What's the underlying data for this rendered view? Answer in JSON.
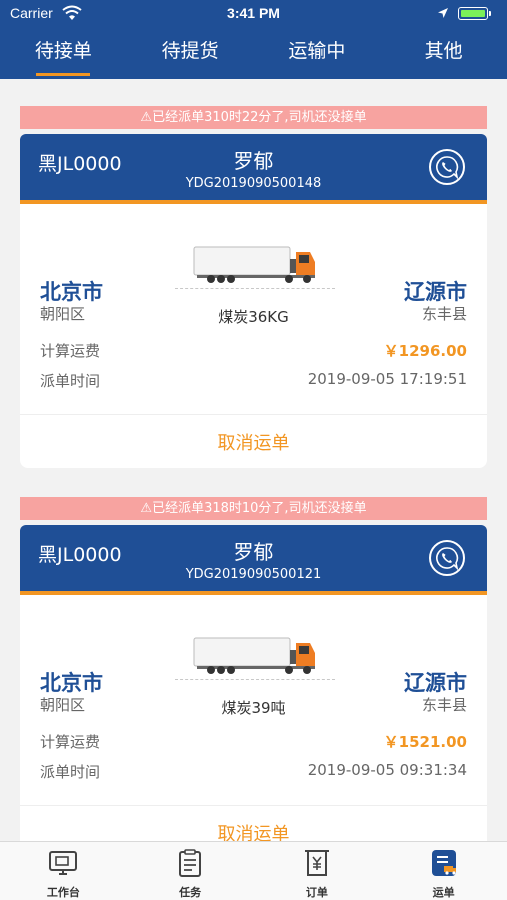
{
  "status_bar": {
    "carrier": "Carrier",
    "time": "3:41 PM"
  },
  "tabs": [
    {
      "label": "待接单",
      "active": true
    },
    {
      "label": "待提货",
      "active": false
    },
    {
      "label": "运输中",
      "active": false
    },
    {
      "label": "其他",
      "active": false
    }
  ],
  "orders": [
    {
      "alert": "⚠已经派单310时22分了,司机还没接单",
      "plate": "黑JL0000",
      "driver": "罗郁",
      "order_no": "YDG2019090500148",
      "from_city": "北京市",
      "from_district": "朝阳区",
      "to_city": "辽源市",
      "to_district": "东丰县",
      "cargo": "煤炭36KG",
      "freight_label": "计算运费",
      "freight": "￥1296.00",
      "dispatch_label": "派单时间",
      "dispatch_time": "2019-09-05 17:19:51",
      "cancel_label": "取消运单"
    },
    {
      "alert": "⚠已经派单318时10分了,司机还没接单",
      "plate": "黑JL0000",
      "driver": "罗郁",
      "order_no": "YDG2019090500121",
      "from_city": "北京市",
      "from_district": "朝阳区",
      "to_city": "辽源市",
      "to_district": "东丰县",
      "cargo": "煤炭39吨",
      "freight_label": "计算运费",
      "freight": "￥1521.00",
      "dispatch_label": "派单时间",
      "dispatch_time": "2019-09-05 09:31:34",
      "cancel_label": "取消运单"
    }
  ],
  "bottom_nav": [
    {
      "label": "工作台",
      "icon": "workbench-icon",
      "active": false
    },
    {
      "label": "任务",
      "icon": "task-icon",
      "active": false
    },
    {
      "label": "订单",
      "icon": "order-icon",
      "active": false
    },
    {
      "label": "运单",
      "icon": "waybill-icon",
      "active": true
    }
  ],
  "colors": {
    "primary": "#1f4f96",
    "accent": "#f29623",
    "alert_bg": "#f7a3a0"
  }
}
